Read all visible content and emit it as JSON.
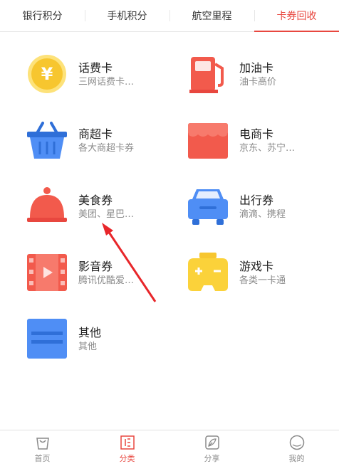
{
  "tabs": [
    {
      "label": "银行积分"
    },
    {
      "label": "手机积分"
    },
    {
      "label": "航空里程"
    },
    {
      "label": "卡券回收"
    }
  ],
  "categories": [
    {
      "title": "话费卡",
      "subtitle": "三网话费卡…",
      "icon": "yuan-coin-icon"
    },
    {
      "title": "加油卡",
      "subtitle": "油卡高价",
      "icon": "gas-pump-icon"
    },
    {
      "title": "商超卡",
      "subtitle": "各大商超卡券",
      "icon": "shopping-basket-icon"
    },
    {
      "title": "电商卡",
      "subtitle": "京东、苏宁…",
      "icon": "storefront-icon"
    },
    {
      "title": "美食券",
      "subtitle": "美团、星巴…",
      "icon": "food-cloche-icon"
    },
    {
      "title": "出行券",
      "subtitle": "滴滴、携程",
      "icon": "car-icon"
    },
    {
      "title": "影音券",
      "subtitle": "腾讯优酷爱…",
      "icon": "film-play-icon"
    },
    {
      "title": "游戏卡",
      "subtitle": "各类一卡通",
      "icon": "gamepad-icon"
    },
    {
      "title": "其他",
      "subtitle": "其他",
      "icon": "card-stack-icon"
    }
  ],
  "bottom_nav": [
    {
      "label": "首页",
      "icon": "bag-icon"
    },
    {
      "label": "分类",
      "icon": "category-list-icon"
    },
    {
      "label": "分享",
      "icon": "feather-icon"
    },
    {
      "label": "我的",
      "icon": "profile-circle-icon"
    }
  ],
  "colors": {
    "accent": "#e8473f",
    "red": "#f25a4c",
    "blue": "#4f8ef5",
    "yellow": "#fbd23a"
  }
}
